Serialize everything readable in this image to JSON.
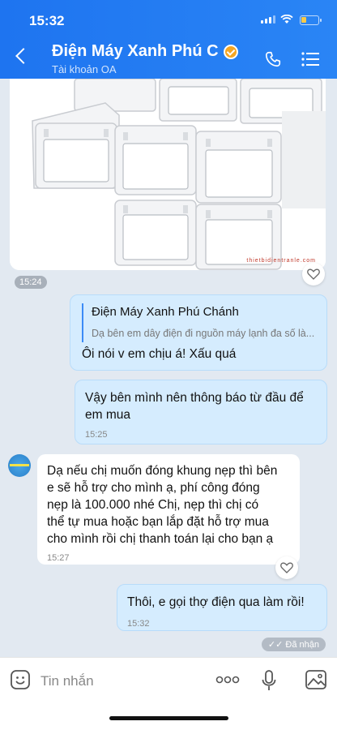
{
  "status_bar": {
    "time": "15:32"
  },
  "header": {
    "title": "Điện Máy Xanh Phú C...",
    "subtitle": "Tài khoản OA"
  },
  "image_message": {
    "watermark": "thietbidientranle.com",
    "time": "15:24"
  },
  "messages": [
    {
      "direction": "outgoing",
      "quote_name": "Điện Máy Xanh Phú Chánh",
      "quote_text": "Dạ bên em dây điện đi nguồn máy lạnh đa số là...",
      "text": "Ôi nói v em chịu á! Xấu quá"
    },
    {
      "direction": "outgoing",
      "text_line1": "Vậy bên mình nên thông báo từ đầu để",
      "text_line2": "em mua",
      "time": "15:25"
    },
    {
      "direction": "incoming",
      "lines": [
        "Dạ nếu chị muốn đóng khung nẹp thì bên",
        "e sẽ hỗ trợ cho mình ạ,  phí công đóng",
        "nẹp là 100.000 nhé Chị,  nẹp thì chị có",
        "thể tự mua hoặc bạn lắp đặt hỗ trợ mua",
        "cho mình rồi chị thanh toán lại cho bạn ạ"
      ],
      "time": "15:27"
    },
    {
      "direction": "outgoing",
      "text": "Thôi, e gọi thợ điện qua làm rồi!",
      "time": "15:32"
    }
  ],
  "delivery_status": "✓✓ Đã nhận",
  "composer": {
    "placeholder": "Tin nhắn"
  },
  "colors": {
    "header": "#1e74f0",
    "outgoing_bubble": "#d5ecfe",
    "chat_bg": "#e2e9f1"
  },
  "icons": [
    "back-icon",
    "verified-icon",
    "phone-icon",
    "menu-icon",
    "heart-icon",
    "sticker-icon",
    "more-icon",
    "mic-icon",
    "image-icon"
  ]
}
